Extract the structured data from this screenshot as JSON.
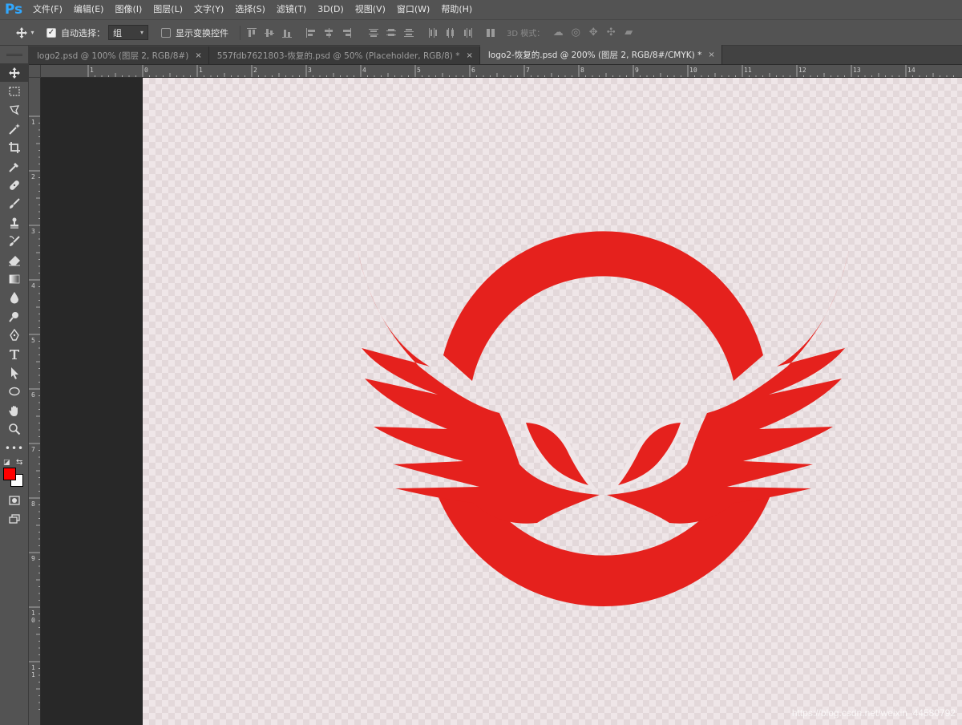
{
  "app": {
    "logo": "Ps"
  },
  "menu": [
    "文件(F)",
    "编辑(E)",
    "图像(I)",
    "图层(L)",
    "文字(Y)",
    "选择(S)",
    "滤镜(T)",
    "3D(D)",
    "视图(V)",
    "窗口(W)",
    "帮助(H)"
  ],
  "options": {
    "move_icon": "move-icon",
    "auto_select_label": "自动选择：",
    "auto_select_checked": true,
    "auto_select_value": "组",
    "show_transform_label": "显示变换控件",
    "show_transform_checked": false,
    "mode_3d_label": "3D 模式："
  },
  "tabs": [
    {
      "title": "logo2.psd @ 100% (图层 2, RGB/8#)",
      "close": "×",
      "active": false
    },
    {
      "title": "557fdb7621803-恢复的.psd @ 50% (Placeholder, RGB/8) *",
      "close": "×",
      "active": false
    },
    {
      "title": "logo2-恢复的.psd @ 200% (图层 2, RGB/8#/CMYK) *",
      "close": "×",
      "active": true
    }
  ],
  "ruler": {
    "horizontal": [
      "1",
      "0",
      "1",
      "2",
      "3",
      "4",
      "5",
      "6",
      "7",
      "8",
      "9",
      "10",
      "11",
      "12",
      "13",
      "14"
    ],
    "vertical": [
      "1",
      "2",
      "3",
      "4",
      "5",
      "6",
      "7",
      "8",
      "9",
      "10",
      "11"
    ]
  },
  "colors": {
    "foreground": "#ff0000",
    "background": "#ffffff",
    "logo_red": "#e5211d"
  },
  "watermark": "https://blog.csdn.net/weixin_44580792"
}
